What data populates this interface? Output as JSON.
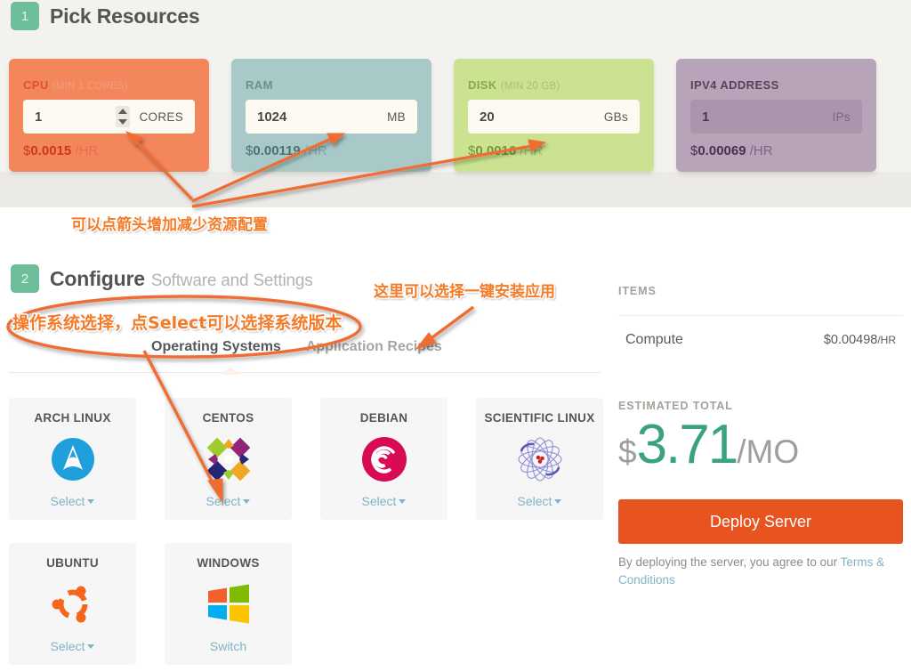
{
  "step1": {
    "badge": "1",
    "title": "Pick Resources",
    "cards": [
      {
        "id": "cpu",
        "title": "CPU",
        "min": "(MIN 1 CORES)",
        "value": "1",
        "unit": "CORES",
        "currency": "$",
        "price": "0.0015",
        "per": "/HR",
        "has_spinner": true,
        "color": "#f4865c"
      },
      {
        "id": "ram",
        "title": "RAM",
        "min": "",
        "value": "1024",
        "unit": "MB",
        "currency": "$",
        "price": "0.00119",
        "per": "/HR",
        "has_spinner": false,
        "color": "#a9c9c8"
      },
      {
        "id": "disk",
        "title": "DISK",
        "min": "(MIN 20 GB)",
        "value": "20",
        "unit": "GBs",
        "currency": "$",
        "price": "0.0016",
        "per": "/HR",
        "has_spinner": false,
        "color": "#cbe391"
      },
      {
        "id": "ipv4",
        "title": "IPV4 ADDRESS",
        "min": "",
        "value": "1",
        "unit": "IPs",
        "currency": "$",
        "price": "0.00069",
        "per": "/HR",
        "has_spinner": false,
        "color": "#b7a4b8"
      }
    ]
  },
  "step2": {
    "badge": "2",
    "title": "Configure",
    "subtitle": "Software and Settings",
    "tabs": [
      {
        "label": "Operating Systems",
        "active": true
      },
      {
        "label": "Application Recipes",
        "active": false
      }
    ],
    "os_cards": [
      {
        "name": "ARCH LINUX",
        "icon": "arch-linux-logo",
        "action": "Select",
        "has_caret": true
      },
      {
        "name": "CENTOS",
        "icon": "centos-logo",
        "action": "Select",
        "has_caret": true
      },
      {
        "name": "DEBIAN",
        "icon": "debian-logo",
        "action": "Select",
        "has_caret": true
      },
      {
        "name": "SCIENTIFIC LINUX",
        "icon": "scientific-linux-logo",
        "action": "Select",
        "has_caret": true
      },
      {
        "name": "UBUNTU",
        "icon": "ubuntu-logo",
        "action": "Select",
        "has_caret": true
      },
      {
        "name": "WINDOWS",
        "icon": "windows-logo",
        "action": "Switch",
        "has_caret": false
      }
    ]
  },
  "summary": {
    "items_label": "ITEMS",
    "items": [
      {
        "name": "Compute",
        "price": "$0.00498",
        "suffix": "/HR"
      }
    ],
    "estimated_label": "ESTIMATED TOTAL",
    "total_currency": "$",
    "total_amount": "3.71",
    "total_period": "/MO",
    "deploy_label": "Deploy Server",
    "terms_prefix": "By deploying the server, you agree to our ",
    "terms_link": "Terms & Conditions"
  },
  "annotations": [
    {
      "id": "note-arrows",
      "text": "可以点箭头增加减少资源配置"
    },
    {
      "id": "note-os-a",
      "text": "操作系统选择，"
    },
    {
      "id": "note-os-b",
      "text": "点"
    },
    {
      "id": "note-os-c",
      "text": "Select"
    },
    {
      "id": "note-os-d",
      "text": "可以选择系统版本"
    },
    {
      "id": "note-recipes",
      "text": "这里可以选择一键安装应用"
    }
  ],
  "colors": {
    "accent_orange": "#e8541f",
    "annotation_orange": "#f47b28",
    "teal_green": "#3aa183",
    "link_blue": "#7fb4c4",
    "badge_green": "#6cbf9a"
  }
}
